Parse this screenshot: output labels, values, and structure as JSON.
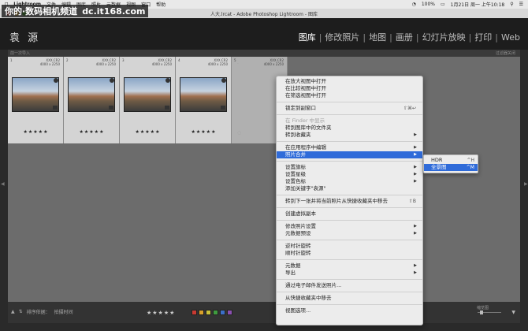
{
  "menubar": {
    "items": [
      "Lightroom",
      "文件",
      "编辑",
      "图库",
      "照片",
      "元数据",
      "视图",
      "窗口",
      "帮助"
    ],
    "wifi_icon": "wifi-icon",
    "battery": "100%",
    "date": "1月21日 周一 上午10:18"
  },
  "watermark": {
    "brand": "你的·数码相机频道",
    "site": "dc.it168.com"
  },
  "window": {
    "title": "人大.lrcat - Adobe Photoshop Lightroom - 图库"
  },
  "identity": "袁 源",
  "modules": [
    "图库",
    "修改照片",
    "地图",
    "画册",
    "幻灯片放映",
    "打印",
    "Web"
  ],
  "grid": {
    "header_left": "前一次导入",
    "header_right": "过滤器关闭",
    "cells": [
      {
        "index": "1",
        "format": "XXX.CR2",
        "dims": "4000 x 2250",
        "stars": "★★★★★",
        "selected": true
      },
      {
        "index": "2",
        "format": "XXX.CR2",
        "dims": "4000 x 2250",
        "stars": "★★★★★",
        "selected": true
      },
      {
        "index": "3",
        "format": "XXX.CR2",
        "dims": "4000 x 2250",
        "stars": "★★★★★",
        "selected": true
      },
      {
        "index": "4",
        "format": "XXX.CR2",
        "dims": "4000 x 2250",
        "stars": "★★★★★",
        "selected": true
      },
      {
        "index": "5",
        "format": "XXX.CR2",
        "dims": "4000 x 2250",
        "stars": "★★★★★",
        "selected": false
      }
    ]
  },
  "toolbar": {
    "sort_label": "排序依据：",
    "sort_value": "拍摄时间",
    "stars": "★★★★★",
    "colors": [
      "#c83a32",
      "#d9a02a",
      "#c9c13a",
      "#3f9c3f",
      "#3b6fc9",
      "#8a4fb0"
    ],
    "thumbs_label": "缩览图"
  },
  "context_menu": {
    "items": [
      {
        "label": "在放大视图中打开",
        "shortcut": "",
        "submenu": false,
        "disabled": false
      },
      {
        "label": "在比较视图中打开",
        "shortcut": "",
        "submenu": false,
        "disabled": false
      },
      {
        "label": "在筛选视图中打开",
        "shortcut": "",
        "submenu": false,
        "disabled": false
      },
      {
        "sep": true
      },
      {
        "label": "锁定到副窗口",
        "shortcut": "⇧⌘↩",
        "submenu": false,
        "disabled": false
      },
      {
        "sep": true
      },
      {
        "label": "在 Finder 中显示",
        "shortcut": "",
        "submenu": false,
        "disabled": true
      },
      {
        "label": "转到图库中的文件夹",
        "shortcut": "",
        "submenu": false,
        "disabled": false
      },
      {
        "label": "转到收藏夹",
        "shortcut": "",
        "submenu": true,
        "disabled": false
      },
      {
        "sep": true
      },
      {
        "label": "在应用程序中编辑",
        "shortcut": "",
        "submenu": true,
        "disabled": false
      },
      {
        "label": "照片合并",
        "shortcut": "",
        "submenu": true,
        "disabled": false,
        "highlight": true
      },
      {
        "sep": true
      },
      {
        "label": "设置旗标",
        "shortcut": "",
        "submenu": true,
        "disabled": false
      },
      {
        "label": "设置星级",
        "shortcut": "",
        "submenu": true,
        "disabled": false
      },
      {
        "label": "设置色标",
        "shortcut": "",
        "submenu": true,
        "disabled": false
      },
      {
        "label": "添加关键字\"袁源\"",
        "shortcut": "",
        "submenu": false,
        "disabled": false
      },
      {
        "sep": true
      },
      {
        "label": "转到下一张并将当前照片从快捷收藏夹中移去",
        "shortcut": "⇧B",
        "submenu": false,
        "disabled": false
      },
      {
        "sep": true
      },
      {
        "label": "创建虚拟副本",
        "shortcut": "",
        "submenu": false,
        "disabled": false
      },
      {
        "sep": true
      },
      {
        "label": "修改照片设置",
        "shortcut": "",
        "submenu": true,
        "disabled": false
      },
      {
        "label": "元数据预设",
        "shortcut": "",
        "submenu": true,
        "disabled": false
      },
      {
        "sep": true
      },
      {
        "label": "逆时针旋转",
        "shortcut": "",
        "submenu": false,
        "disabled": false
      },
      {
        "label": "顺时针旋转",
        "shortcut": "",
        "submenu": false,
        "disabled": false
      },
      {
        "sep": true
      },
      {
        "label": "元数据",
        "shortcut": "",
        "submenu": true,
        "disabled": false
      },
      {
        "label": "导出",
        "shortcut": "",
        "submenu": true,
        "disabled": false
      },
      {
        "sep": true
      },
      {
        "label": "通过电子邮件发送照片...",
        "shortcut": "",
        "submenu": false,
        "disabled": false
      },
      {
        "sep": true
      },
      {
        "label": "从快捷收藏夹中移去",
        "shortcut": "",
        "submenu": false,
        "disabled": false
      },
      {
        "sep": true
      },
      {
        "label": "视图选项...",
        "shortcut": "",
        "submenu": false,
        "disabled": false
      }
    ]
  },
  "submenu": {
    "items": [
      {
        "label": "HDR",
        "shortcut": "^H",
        "highlight": false
      },
      {
        "label": "全景图",
        "shortcut": "^M",
        "highlight": true
      }
    ]
  }
}
